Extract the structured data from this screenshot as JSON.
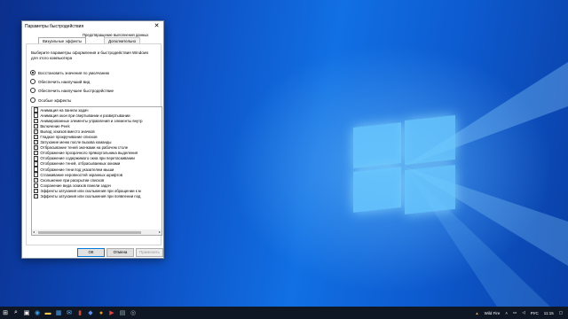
{
  "dialog": {
    "title": "Параметры быстродействия",
    "close_glyph": "✕",
    "tab_prevention": "Предотвращение выполнения данных",
    "tab_visual": "Визуальные эффекты",
    "tab_advanced": "Дополнительно",
    "description": "Выберите параметры оформления и быстродействия Windows для этого компьютера",
    "radios": [
      {
        "label": "Восстановить значения по умолчанию",
        "selected": true
      },
      {
        "label": "Обеспечить наилучший вид",
        "selected": false
      },
      {
        "label": "Обеспечить наилучшее быстродействие",
        "selected": false
      },
      {
        "label": "Особые эффекты",
        "selected": false
      }
    ],
    "effects": [
      {
        "label": "Анимация на панели задач",
        "checked": true
      },
      {
        "label": "Анимация окон при свертывании и развертывании",
        "checked": true
      },
      {
        "label": "Анимированные элементы управления и элементы внутр",
        "checked": true
      },
      {
        "label": "Включение Peek",
        "checked": true
      },
      {
        "label": "Вывод эскизов вместо значков",
        "checked": true
      },
      {
        "label": "Гладкое прокручивание списков",
        "checked": true
      },
      {
        "label": "Затухание меню после вызова команды",
        "checked": true
      },
      {
        "label": "Отбрасывание теней значками на рабочем столе",
        "checked": true
      },
      {
        "label": "Отображение прозрачного прямоугольника выделения",
        "checked": true
      },
      {
        "label": "Отображение содержимого окна при перетаскивании",
        "checked": true
      },
      {
        "label": "Отображение теней, отбрасываемых окнами",
        "checked": true
      },
      {
        "label": "Отображение тени под указателем мыши",
        "checked": false
      },
      {
        "label": "Сглаживание неровностей экранных шрифтов",
        "checked": true
      },
      {
        "label": "Скольжение при раскрытии списков",
        "checked": true
      },
      {
        "label": "Сохранение вида эскизов панели задач",
        "checked": false
      },
      {
        "label": "Эффекты затухания или скольжения при обращении к м",
        "checked": true
      },
      {
        "label": "Эффекты затухания или скольжения при появлении под",
        "checked": true
      }
    ],
    "ok_label": "ОК",
    "cancel_label": "Отмена",
    "apply_label": "Применить"
  },
  "taskbar": {
    "icons": [
      "start-icon",
      "search-icon",
      "task-view-icon",
      "edge-icon",
      "explorer-icon",
      "store-icon",
      "mail-icon",
      "app-icon",
      "photos-icon",
      "chrome-icon",
      "media-icon",
      "terminal-icon",
      "camera-icon"
    ],
    "tray_app": "Wild Fire",
    "language": "РУС",
    "time": "11:15"
  },
  "colors": {
    "accent": "#0078d7",
    "taskbar": "#101724",
    "desktop": "#0d4ec2"
  }
}
